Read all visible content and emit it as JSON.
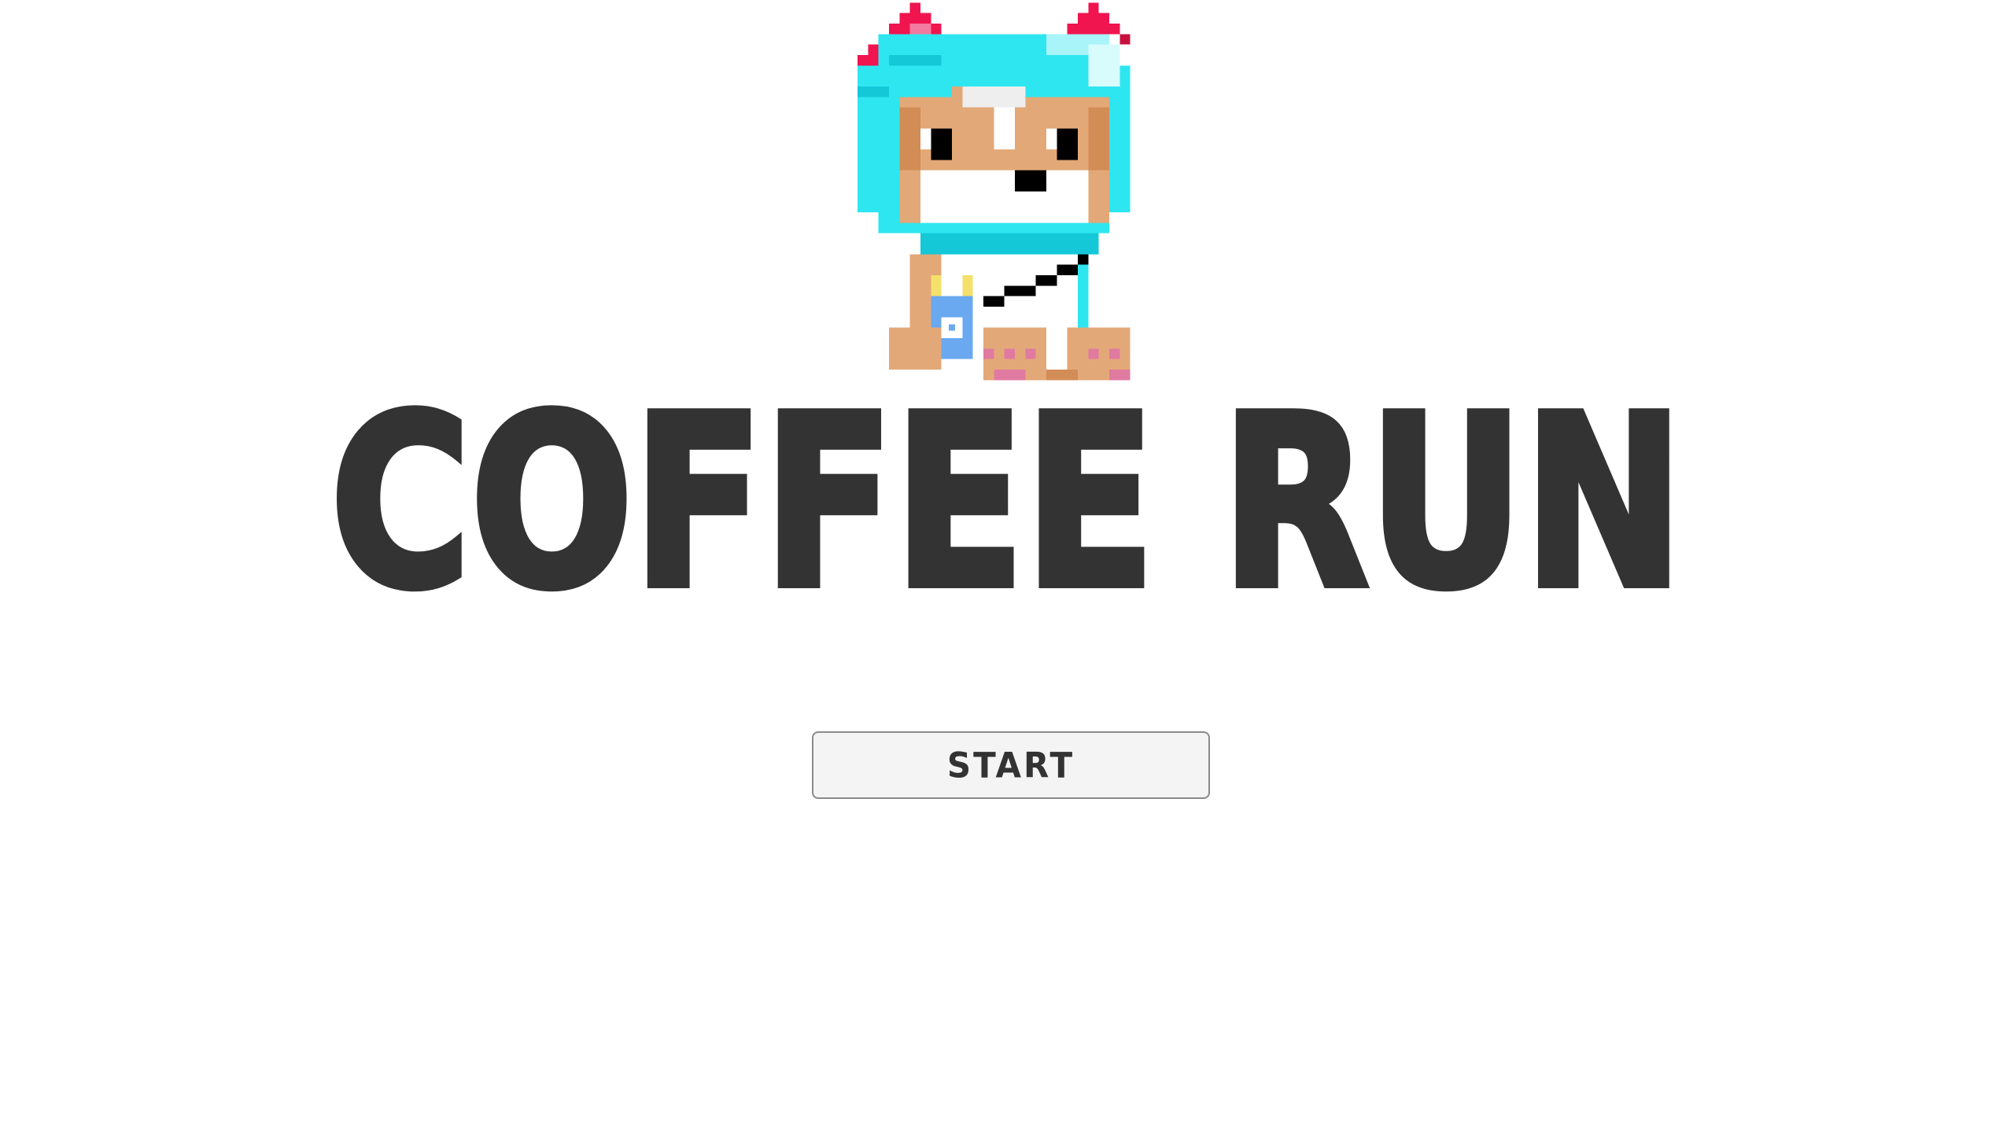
{
  "game": {
    "title": "COFFEE RUN",
    "start_label": "START"
  },
  "colors": {
    "background": "#ffffff",
    "title": "#333333",
    "button_bg": "#f4f4f4",
    "button_border": "#8a8a8a",
    "mascot_hood": "#2ee6f0",
    "mascot_ears": "#f0144f",
    "mascot_fur": "#e3a878"
  },
  "icons": {
    "mascot": "pixel-cat-mascot-icon",
    "coffee_cup": "coffee-cup-icon"
  }
}
